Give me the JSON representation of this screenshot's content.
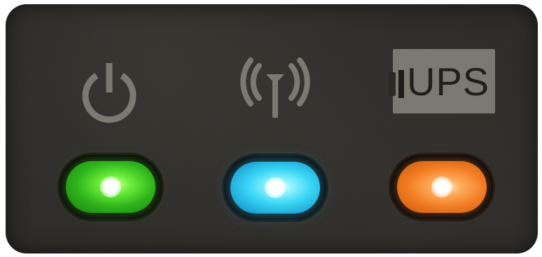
{
  "device_panel": {
    "icons": {
      "power": "power-icon",
      "wireless": "wireless-antenna-icon"
    },
    "ups_badge": {
      "label": "UPS"
    },
    "leds": [
      {
        "name": "power-led",
        "color": "#3cd424",
        "state": "on"
      },
      {
        "name": "wireless-led",
        "color": "#3ad6f6",
        "state": "on"
      },
      {
        "name": "ups-led",
        "color": "#f27c22",
        "state": "on"
      }
    ],
    "colors": {
      "panel": "#2b2a27",
      "icon_print": "#7a7a72"
    }
  }
}
